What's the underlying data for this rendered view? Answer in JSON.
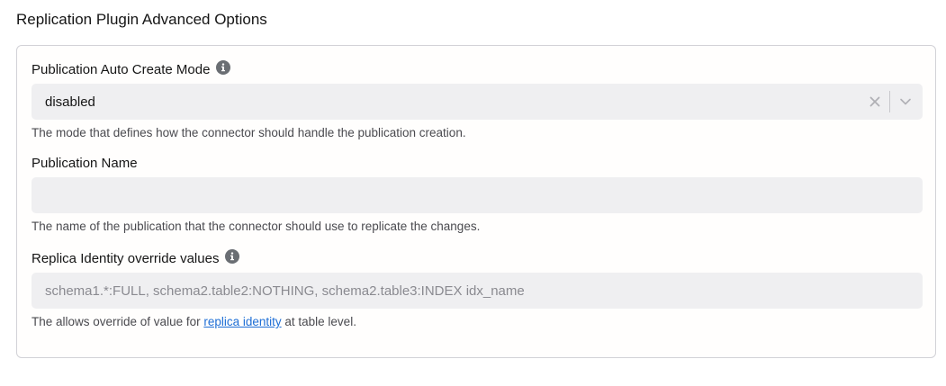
{
  "section": {
    "title": "Replication Plugin Advanced Options"
  },
  "fields": {
    "publication_auto_create_mode": {
      "label": "Publication Auto Create Mode",
      "value": "disabled",
      "help": "The mode that defines how the connector should handle the publication creation."
    },
    "publication_name": {
      "label": "Publication Name",
      "value": "",
      "placeholder": "",
      "help": "The name of the publication that the connector should use to replicate the changes."
    },
    "replica_identity": {
      "label": "Replica Identity override values",
      "value": "",
      "placeholder": "schema1.*:FULL, schema2.table2:NOTHING, schema2.table3:INDEX idx_name",
      "help_prefix": "The allows override of value for ",
      "help_link": "replica identity",
      "help_suffix": " at table level."
    }
  },
  "colors": {
    "input_bg": "#efeff1",
    "link": "#1f6fd6",
    "info_icon": "#6a6e73",
    "panel_border": "#d2d2d7"
  }
}
